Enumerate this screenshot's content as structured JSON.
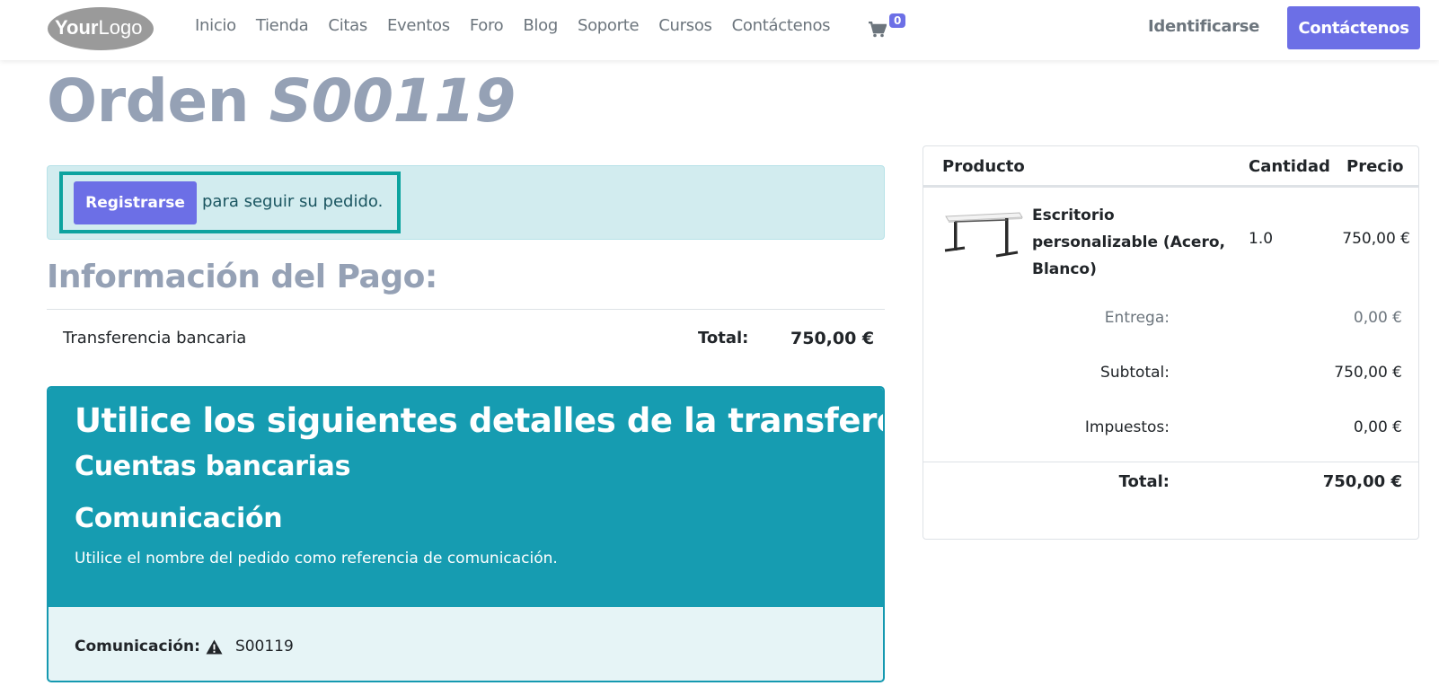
{
  "header": {
    "logo_text": "YourLogo",
    "nav": [
      "Inicio",
      "Tienda",
      "Citas",
      "Eventos",
      "Foro",
      "Blog",
      "Soporte",
      "Cursos",
      "Contáctenos"
    ],
    "cart_count": "0",
    "login_label": "Identificarse",
    "contact_button": "Contáctenos"
  },
  "page": {
    "title_word": "Orden",
    "order_number": "S00119"
  },
  "alert": {
    "register_button": "Registrarse",
    "text": "para seguir su pedido."
  },
  "payment": {
    "title": "Información del Pago:",
    "method": "Transferencia bancaria",
    "total_label": "Total:",
    "total_value": "750,00 €"
  },
  "transfer": {
    "heading": "Utilice los siguientes detalles de la transferencia",
    "bank_accounts": "Cuentas bancarias",
    "communication_heading": "Comunicación",
    "instruction": "Utilice el nombre del pedido como referencia de comunicación.",
    "communication_label": "Comunicación:",
    "communication_value": "S00119"
  },
  "summary": {
    "col_product": "Producto",
    "col_qty": "Cantidad",
    "col_price": "Precio",
    "product_name": "Escritorio personalizable (Acero, Blanco)",
    "product_qty": "1.0",
    "product_price": "750,00 €",
    "delivery_label": "Entrega:",
    "delivery_value": "0,00 €",
    "subtotal_label": "Subtotal:",
    "subtotal_value": "750,00 €",
    "taxes_label": "Impuestos:",
    "taxes_value": "0,00 €",
    "total_label": "Total:",
    "total_value": "750,00 €"
  },
  "colors": {
    "brand": "#6c6fe6",
    "title_gray": "#95a1b5",
    "transfer_teal": "#169cb1",
    "highlight": "#0ca39f"
  },
  "icons": {
    "cart": "cart-icon",
    "warning": "warning-icon",
    "product_image": "desk-image"
  }
}
